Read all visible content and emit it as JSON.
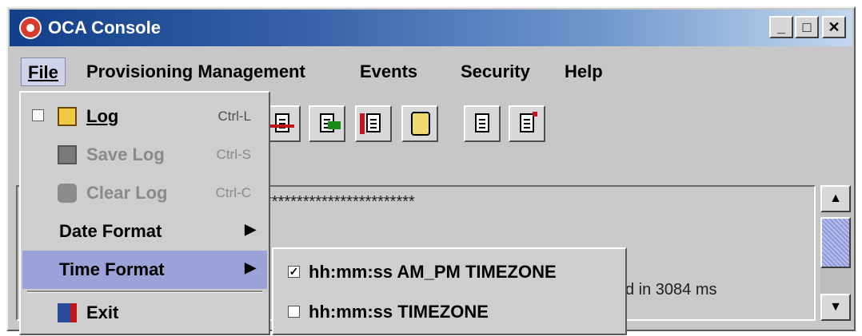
{
  "window": {
    "title": "OCA Console"
  },
  "titlebar_buttons": {
    "minimize": "_",
    "maximize": "□",
    "close": "✕"
  },
  "menubar": [
    {
      "label": "File",
      "active": true
    },
    {
      "label": "Provisioning Management"
    },
    {
      "label": "Events"
    },
    {
      "label": "Security"
    },
    {
      "label": "Help"
    }
  ],
  "file_menu": {
    "log": {
      "label": "Log",
      "shortcut": "Ctrl-L",
      "checked": false
    },
    "save_log": {
      "label": "Save Log",
      "shortcut": "Ctrl-S",
      "disabled": true
    },
    "clear_log": {
      "label": "Clear Log",
      "shortcut": "Ctrl-C",
      "disabled": true
    },
    "date_format": {
      "label": "Date Format"
    },
    "time_format": {
      "label": "Time Format",
      "highlighted": true
    },
    "exit": {
      "label": "Exit"
    }
  },
  "time_format_submenu": [
    {
      "label": "hh:mm:ss AM_PM TIMEZONE",
      "checked": true
    },
    {
      "label": "hh:mm:ss TIMEZONE",
      "checked": false
    }
  ],
  "log": {
    "line1": "************************",
    "line2": "d in 3084 ms"
  },
  "scrollbar": {
    "up": "▲",
    "down": "▼"
  },
  "icons": [
    "oca-console-icon",
    "folder-open-icon",
    "save-disk-icon",
    "clear-can-icon",
    "exit-door-icon",
    "submenu-arrow-icon",
    "toolbar-doc-icons"
  ]
}
